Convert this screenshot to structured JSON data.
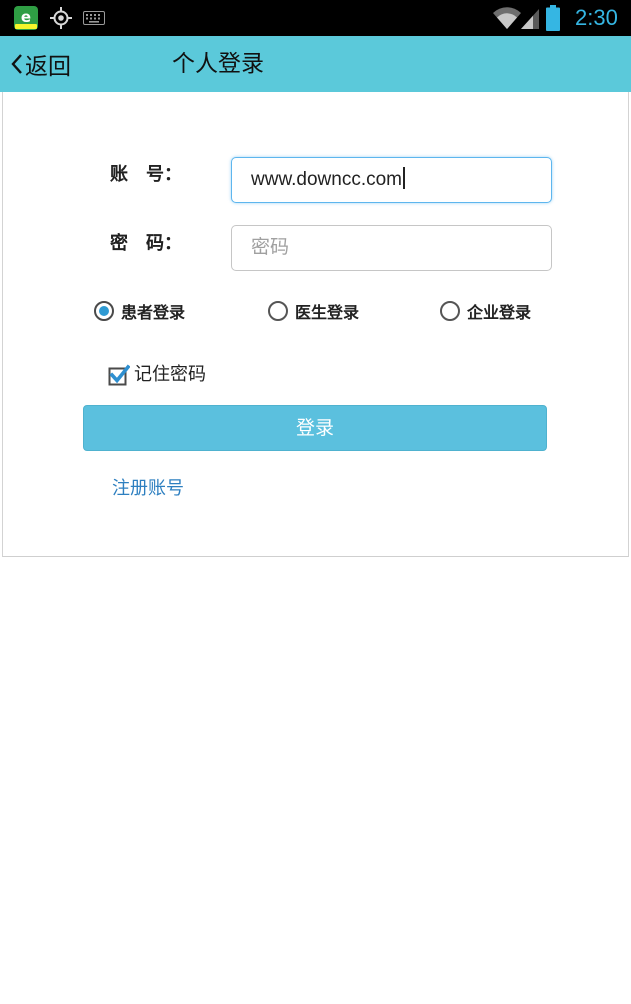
{
  "status_bar": {
    "time": "2:30",
    "app_icon_letter": "e",
    "icons": [
      "app-notification-icon",
      "gps-icon",
      "keyboard-icon",
      "wifi-icon",
      "signal-icon",
      "battery-icon"
    ],
    "time_color": "#35b6e3"
  },
  "app_bar": {
    "back_label": "返回",
    "title": "个人登录",
    "background_color": "#5bc9da"
  },
  "form": {
    "account_label": "账　号：",
    "account_value": "www.downcc.com",
    "password_label": "密　码：",
    "password_placeholder": "密码",
    "login_types": [
      {
        "label": "患者登录",
        "selected": true
      },
      {
        "label": "医生登录",
        "selected": false
      },
      {
        "label": "企业登录",
        "selected": false
      }
    ],
    "remember_label": "记住密码",
    "remember_checked": true,
    "login_button": "登录",
    "register_link": "注册账号",
    "accent_color": "#5bc0de",
    "link_color": "#2d7fc0"
  }
}
